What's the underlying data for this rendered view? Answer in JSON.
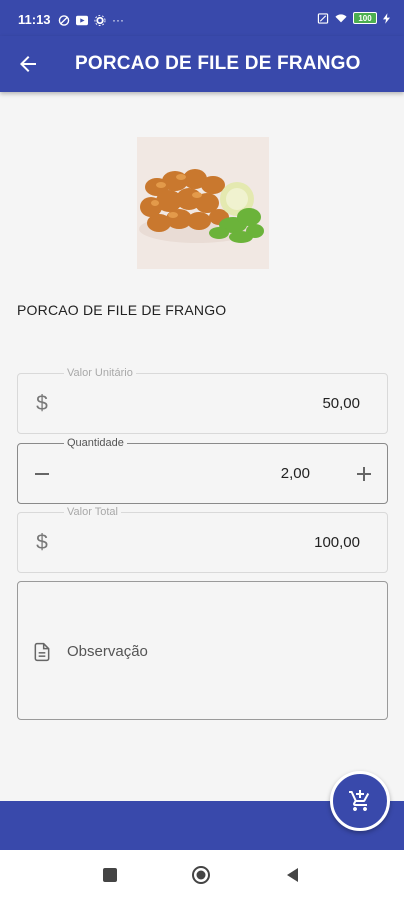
{
  "status_bar": {
    "time": "11:13",
    "left_icons": [
      "no-disturb-icon",
      "youtube-icon",
      "settings-icon",
      "more-icon"
    ],
    "right_icons": [
      "sim-icon",
      "wifi-icon",
      "battery-icon",
      "charging-icon"
    ],
    "battery_level": "100",
    "more": "···"
  },
  "app_bar": {
    "title": "PORCAO DE FILE DE FRANGO",
    "back_icon": "arrow-left-icon",
    "color": "#3949ab"
  },
  "product": {
    "name": "PORCAO DE FILE DE FRANGO"
  },
  "unit_price": {
    "label": "Valor Unitário",
    "prefix": "$",
    "value": "50,00"
  },
  "quantity": {
    "label": "Quantidade",
    "value": "2,00"
  },
  "total": {
    "label": "Valor Total",
    "prefix": "$",
    "value": "100,00"
  },
  "observation": {
    "placeholder": "Observação"
  },
  "fab": {
    "icon": "add-to-cart-icon"
  },
  "colors": {
    "primary": "#3949ab",
    "background": "#f5f5f5"
  }
}
